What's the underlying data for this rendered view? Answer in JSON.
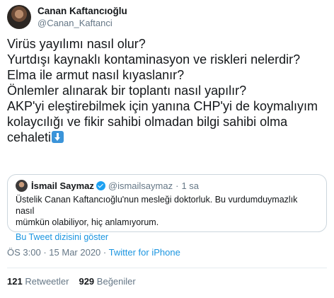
{
  "author": {
    "display_name": "Canan Kaftancıoğlu",
    "handle": "@Canan_Kaftanci"
  },
  "tweet": {
    "lines": [
      "Virüs yayılımı nasıl olur?",
      "Yurtdışı kaynaklı kontaminasyon ve riskleri nelerdir?",
      "Elma ile armut nasıl kıyaslanır?",
      "Önlemler alınarak bir toplantı nasıl yapılır?",
      "AKP'yi eleştirebilmek için yanına CHP'yi de koymalıyım",
      "kolaycılığı ve fikir sahibi olmadan bilgi sahibi olma",
      "cehaleti"
    ],
    "trailing_icon": "down-arrow-emoji"
  },
  "quoted_tweet": {
    "display_name": "İsmail Saymaz",
    "handle": "@ismailsaymaz",
    "separator": "·",
    "time": "1 sa",
    "verified_icon": "verified-badge-icon",
    "text_lines": [
      "Üstelik Canan Kaftancıoğlu'nun mesleği doktorluk. Bu vurdumduymazlık nasıl",
      "mümkün olabiliyor, hiç anlamıyorum."
    ],
    "thread_link": "Bu Tweet dizisini göster"
  },
  "meta": {
    "time": "ÖS 3:00",
    "separator": "·",
    "date": "15 Mar 2020",
    "via": "Twitter for iPhone"
  },
  "stats": {
    "retweets_count": "121",
    "retweets_label": "Retweetler",
    "likes_count": "929",
    "likes_label": "Beğeniler"
  },
  "colors": {
    "link": "#1b95e0",
    "secondary_text": "#657786",
    "verified": "#1da1f2",
    "border": "#ccd6dd"
  }
}
